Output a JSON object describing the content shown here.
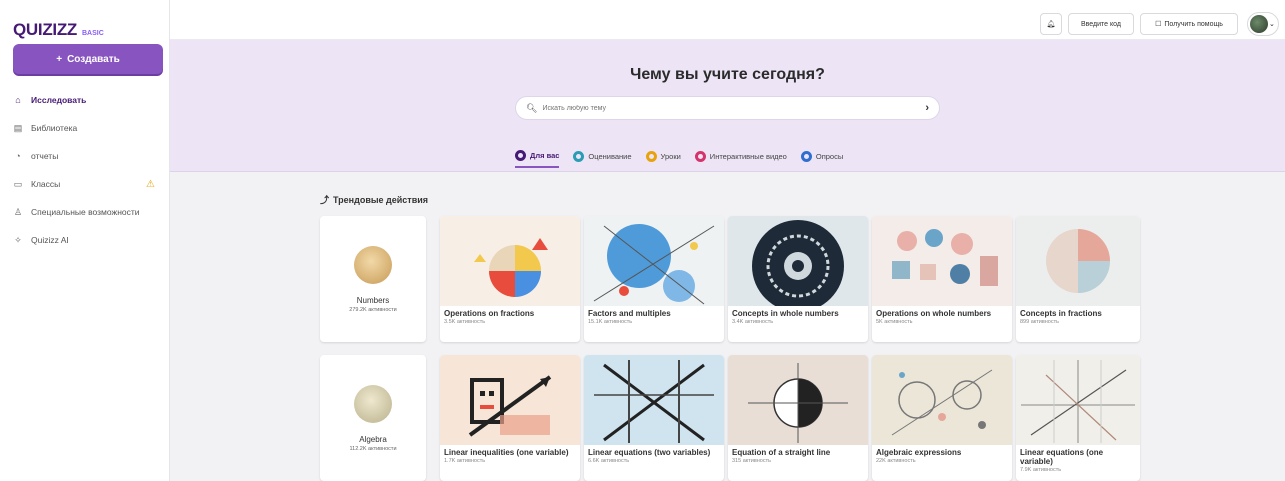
{
  "sidebar": {
    "logo": "QUIZIZZ",
    "plan": "BASIC",
    "create_label": "Создавать",
    "items": [
      {
        "label": "Исследовать",
        "icon": "home-icon"
      },
      {
        "label": "Библиотека",
        "icon": "library-icon"
      },
      {
        "label": "отчеты",
        "icon": "reports-icon"
      },
      {
        "label": "Классы",
        "icon": "classes-icon"
      },
      {
        "label": "Специальные возможности",
        "icon": "accessibility-icon"
      },
      {
        "label": "Quizizz AI",
        "icon": "ai-icon"
      }
    ]
  },
  "topbar": {
    "join_label": "Введите код",
    "help_label": "Получить помощь"
  },
  "hero": {
    "title": "Чему вы учите сегодня?",
    "search_placeholder": "Искать любую тему",
    "tabs": [
      {
        "label": "Для вас",
        "color": "#461a74"
      },
      {
        "label": "Оценивание",
        "color": "#2a9db5"
      },
      {
        "label": "Уроки",
        "color": "#e8a30c"
      },
      {
        "label": "Интерактивные видео",
        "color": "#d6336c"
      },
      {
        "label": "Опросы",
        "color": "#2f6fd1"
      }
    ]
  },
  "trending": {
    "title": "Трендовые действия",
    "rows": [
      {
        "topic": {
          "title": "Numbers",
          "meta": "279.2K активности"
        },
        "cards": [
          {
            "title": "Operations on fractions",
            "meta": "3.5K активность"
          },
          {
            "title": "Factors and multiples",
            "meta": "15.1K активность"
          },
          {
            "title": "Concepts in whole numbers",
            "meta": "3.4K активность"
          },
          {
            "title": "Operations on whole numbers",
            "meta": "5K активность"
          },
          {
            "title": "Concepts in fractions",
            "meta": "899 активность"
          }
        ]
      },
      {
        "topic": {
          "title": "Algebra",
          "meta": "112.2K активности"
        },
        "cards": [
          {
            "title": "Linear inequalities (one variable)",
            "meta": "1.7K активность"
          },
          {
            "title": "Linear equations (two variables)",
            "meta": "6.6K активность"
          },
          {
            "title": "Equation of a straight line",
            "meta": "315 активность"
          },
          {
            "title": "Algebraic expressions",
            "meta": "22K активность"
          },
          {
            "title": "Linear equations (one variable)",
            "meta": "7.9K активность"
          }
        ]
      }
    ]
  }
}
